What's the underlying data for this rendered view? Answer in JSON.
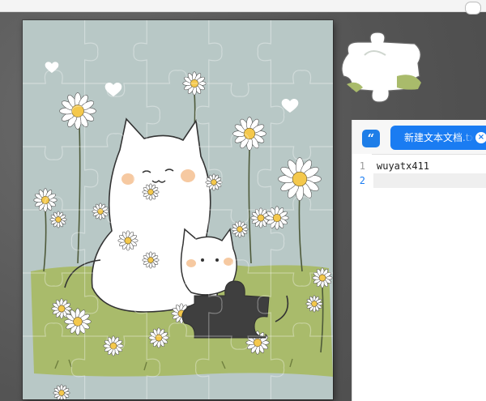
{
  "colors": {
    "board_bg": "#b8c8c6",
    "grass": "#a9bb6b",
    "accent_blue": "#1a7cf2",
    "flower_center": "#f4c84c",
    "petal": "#ffffff",
    "missing_hole": "#3f3f3f"
  },
  "puzzle": {
    "icons": [
      "cat-icon",
      "kitten-icon",
      "daisy-icon",
      "heart-icon",
      "puzzle-piece-icon"
    ]
  },
  "editor": {
    "app_icon_glyph": "“",
    "tab": {
      "title": "新建文本文档.txt",
      "close_glyph": "×"
    },
    "lines": [
      {
        "number": "1",
        "text": "wuyatx411"
      },
      {
        "number": "2",
        "text": ""
      }
    ]
  }
}
